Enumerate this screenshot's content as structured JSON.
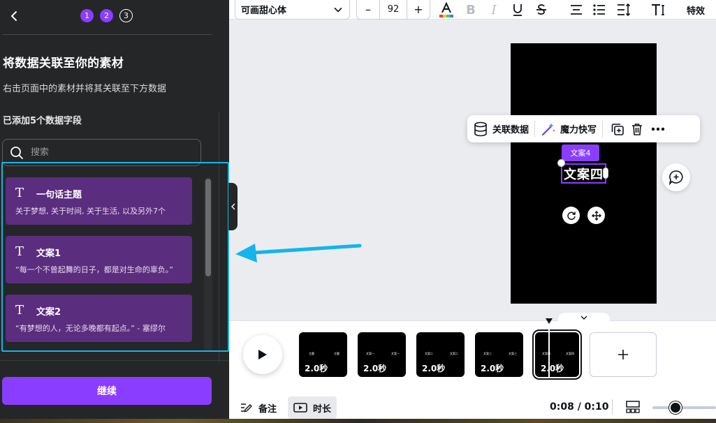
{
  "panel": {
    "steps": [
      "1",
      "2",
      "3"
    ],
    "title": "将数据关联至你的素材",
    "subtitle": "右击页面中的素材并将其关联至下方数据",
    "fields_count": "已添加5个数据字段",
    "search_placeholder": "搜索",
    "fields": [
      {
        "name": "一句话主题",
        "preview": "关于梦想, 关于时间, 关于生活, 以及另外7个"
      },
      {
        "name": "文案1",
        "preview": "“每一个不曾起舞的日子，都是对生命的辜负。”"
      },
      {
        "name": "文案2",
        "preview": "“有梦想的人，无论多晚都有起点。” - 塞缪尔"
      }
    ],
    "continue_label": "继续"
  },
  "toolbar": {
    "font_name": "可画甜心体",
    "minus": "–",
    "font_size": "92",
    "plus": "+",
    "effects_label": "特效",
    "text_color": "#0e1318"
  },
  "context_toolbar": {
    "link_data": "关联数据",
    "magic_write": "魔力快写"
  },
  "canvas": {
    "tag_label": "文案4",
    "selected_text": "文案四"
  },
  "timeline": {
    "pages": [
      {
        "duration": "2.0秒",
        "labels": [
          "主题",
          "主题"
        ]
      },
      {
        "duration": "2.0秒",
        "labels": [
          "文案一",
          "文案一"
        ]
      },
      {
        "duration": "2.0秒",
        "labels": [
          "文案二",
          "文案二"
        ]
      },
      {
        "duration": "2.0秒",
        "labels": [
          "文案三",
          "文案三"
        ]
      },
      {
        "duration": "2.0秒",
        "labels": [
          "文案四",
          "文案四"
        ],
        "selected": true
      }
    ],
    "notes_label": "备注",
    "duration_label": "时长",
    "timecode": "0:08 / 0:10"
  },
  "colors": {
    "accent": "#8b3dff",
    "annotation_arrow": "#13b5ea",
    "panel_bg": "#252627",
    "field_card": "#5b2d7e"
  }
}
